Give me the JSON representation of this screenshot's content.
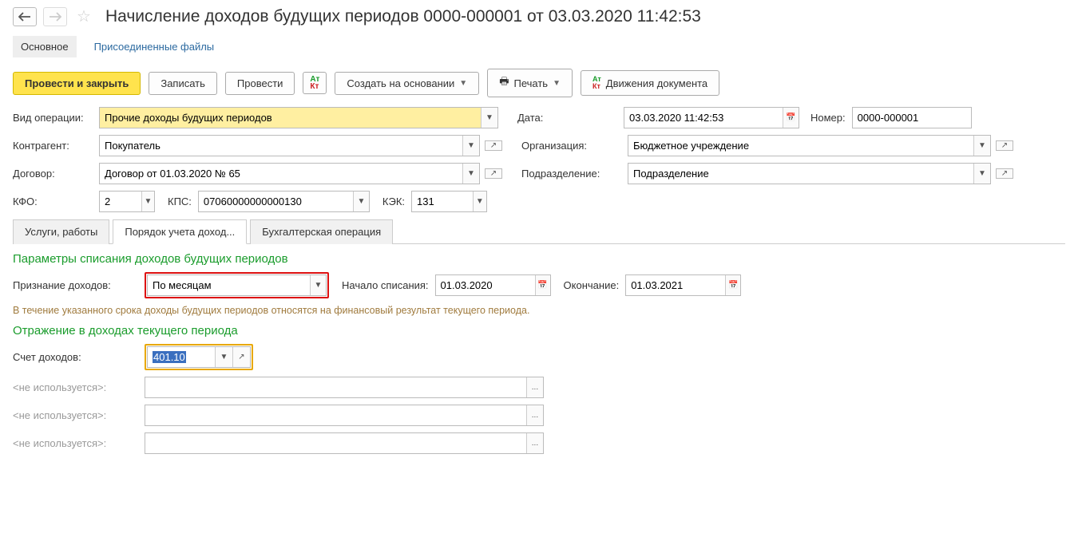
{
  "header": {
    "title": "Начисление доходов будущих периодов 0000-000001 от 03.03.2020 11:42:53"
  },
  "link_tabs": [
    "Основное",
    "Присоединенные файлы"
  ],
  "toolbar": {
    "post_close": "Провести и закрыть",
    "write": "Записать",
    "post": "Провести",
    "create_based": "Создать на основании",
    "print": "Печать",
    "movements": "Движения документа"
  },
  "fields": {
    "op_label": "Вид операции:",
    "op_value": "Прочие доходы будущих периодов",
    "date_label": "Дата:",
    "date_value": "03.03.2020 11:42:53",
    "num_label": "Номер:",
    "num_value": "0000-000001",
    "contr_label": "Контрагент:",
    "contr_value": "Покупатель",
    "org_label": "Организация:",
    "org_value": "Бюджетное учреждение",
    "dog_label": "Договор:",
    "dog_value": "Договор от 01.03.2020 № 65",
    "dept_label": "Подразделение:",
    "dept_value": "Подразделение",
    "kfo_label": "КФО:",
    "kfo_value": "2",
    "kps_label": "КПС:",
    "kps_value": "07060000000000130",
    "kek_label": "КЭК:",
    "kek_value": "131"
  },
  "tabs": [
    "Услуги, работы",
    "Порядок учета доход...",
    "Бухгалтерская операция"
  ],
  "sections": {
    "params_title": "Параметры списания доходов будущих периодов",
    "recognition_label": "Признание доходов:",
    "recognition_value": "По месяцам",
    "start_label": "Начало списания:",
    "start_value": "01.03.2020",
    "end_label": "Окончание:",
    "end_value": "01.03.2021",
    "hint": "В течение указанного срока доходы будущих периодов относятся на финансовый результат текущего периода.",
    "reflection_title": "Отражение в доходах текущего периода",
    "account_label": "Счет доходов:",
    "account_value": "401.10",
    "unused": "<не используется>:"
  }
}
